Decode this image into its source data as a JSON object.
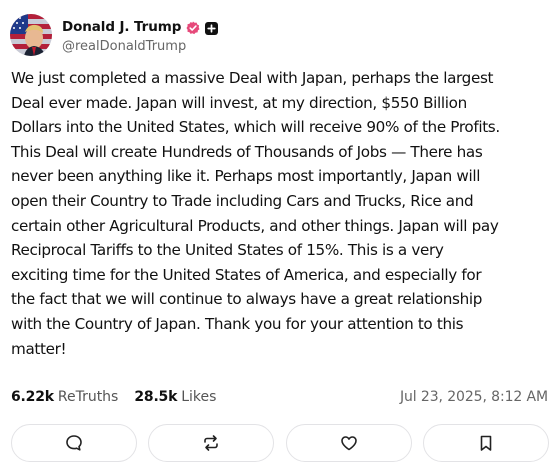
{
  "author": {
    "display_name": "Donald J. Trump",
    "handle": "@realDonaldTrump",
    "icons": [
      "avatar",
      "verified-badge-icon",
      "plus-badge-icon"
    ],
    "verified_color": "#e6497a"
  },
  "post": {
    "text": "We just completed a massive Deal with Japan, perhaps the largest\nDeal ever made. Japan will invest, at my direction, $550 Billion\nDollars into the United States, which will receive 90% of the Profits.\nThis Deal will create Hundreds of Thousands of Jobs — There has\nnever been anything like it. Perhaps most importantly, Japan will\nopen their Country to Trade including Cars and Trucks, Rice and\ncertain other Agricultural Products, and other things. Japan will pay\nReciprocal Tariffs to the United States of 15%. This is a very\nexciting time for the United States of America, and especially for\nthe fact that we will continue to always have a great relationship\nwith the Country of Japan. Thank you for your attention to this\nmatter!"
  },
  "stats": {
    "retruths_count": "6.22k",
    "retruths_label": "ReTruths",
    "likes_count": "28.5k",
    "likes_label": "Likes"
  },
  "timestamp": "Jul 23, 2025, 8:12 AM",
  "actions": [
    {
      "icon": "reply-icon"
    },
    {
      "icon": "retruth-icon"
    },
    {
      "icon": "like-heart-icon"
    },
    {
      "icon": "bookmark-icon"
    }
  ]
}
